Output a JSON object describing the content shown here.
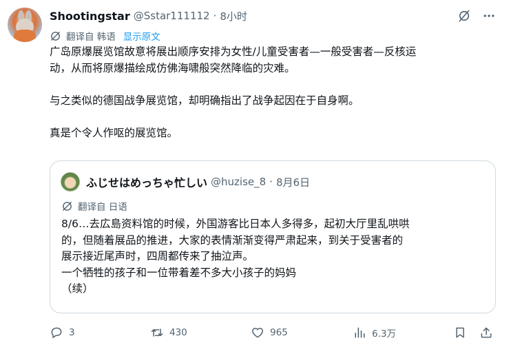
{
  "tweet": {
    "author_name": "Shootingstar",
    "author_handle": "@Sstar111112",
    "separator": "·",
    "time": "8小时",
    "translated_from": "翻译自 韩语",
    "show_original": "显示原文",
    "text_lines": [
      "广岛原爆展览馆故意将展出顺序安排为女性/儿童受害者—一般受害者—反核运",
      "动，从而将原爆描绘成仿佛海啸般突然降临的灾难。",
      "",
      "与之类似的德国战争展览馆，却明确指出了战争起因在于自身啊。",
      "",
      "真是个令人作呕的展览馆。"
    ]
  },
  "quote": {
    "author_name": "ふじせはめっちゃ忙しい",
    "author_handle": "@huzise_8",
    "separator": "·",
    "date": "8月6日",
    "translated_from": "翻译自 日语",
    "text_lines": [
      "8/6…去広島资料馆的时候，外国游客比日本人多得多，起初大厅里乱哄哄",
      "的，但随着展品的推进，大家的表情渐渐变得严肃起来，到关于受害者的",
      "展示接近尾声时，四周都传来了抽泣声。",
      "一个牺牲的孩子和一位带着差不多大小孩子的妈妈",
      "（续）"
    ]
  },
  "actions": {
    "replies": "3",
    "retweets": "430",
    "likes": "965",
    "views": "6.3万"
  },
  "icons": {
    "translate": "translate-icon",
    "grok": "grok-icon",
    "more": "more-icon",
    "reply": "reply-icon",
    "retweet": "retweet-icon",
    "like": "like-icon",
    "views": "views-icon",
    "bookmark": "bookmark-icon",
    "share": "share-icon"
  },
  "colors": {
    "text": "#0f1419",
    "secondary": "#536471",
    "link": "#1d9bf0",
    "border": "#cfd9de"
  }
}
